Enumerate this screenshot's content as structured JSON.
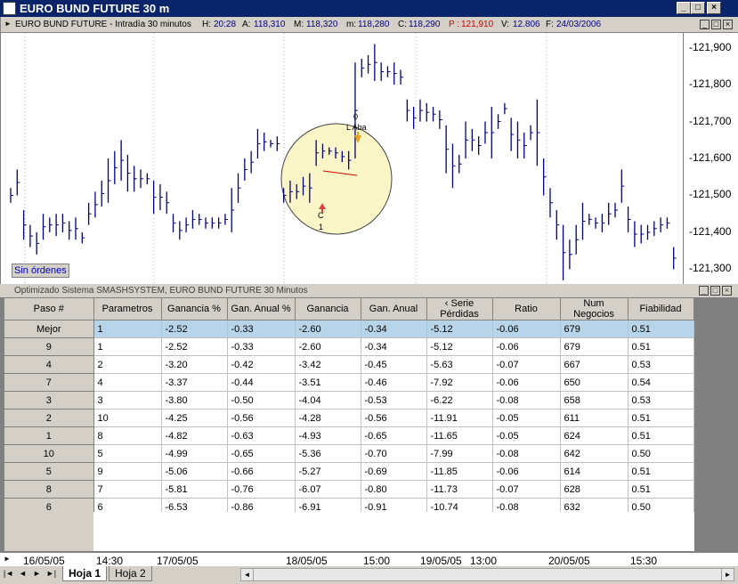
{
  "window": {
    "title": "EURO BUND FUTURE 30 m"
  },
  "infobar": {
    "instrument": "EURO BUND FUTURE - Intradía 30 minutos",
    "h_label": "H:",
    "h_value": "20:28",
    "a_label": "A:",
    "a_value": "118,310",
    "m_label": "M:",
    "m_value": "118,320",
    "mm_label": "m:",
    "mm_value": "118,280",
    "c_label": "C:",
    "c_value": "118,290",
    "p_label": "P :",
    "p_value": "121,910",
    "v_label": "V:",
    "v_value": "12.806",
    "f_label": "F:",
    "f_value": "24/03/2006"
  },
  "chart_data": {
    "type": "bar",
    "ohlc_price_axis": [
      "121,900",
      "121,800",
      "121,700",
      "121,600",
      "121,500",
      "121,400",
      "121,300"
    ],
    "ylim": [
      121260,
      121940
    ],
    "annotations": [
      "0",
      "L Aba",
      "C",
      "1"
    ],
    "bars": [
      [
        121520,
        121480
      ],
      [
        121570,
        121500
      ],
      [
        121460,
        121380
      ],
      [
        121420,
        121360
      ],
      [
        121400,
        121340
      ],
      [
        121450,
        121380
      ],
      [
        121440,
        121400
      ],
      [
        121450,
        121390
      ],
      [
        121450,
        121400
      ],
      [
        121430,
        121380
      ],
      [
        121440,
        121380
      ],
      [
        121400,
        121370
      ],
      [
        121480,
        121420
      ],
      [
        121510,
        121440
      ],
      [
        121540,
        121470
      ],
      [
        121600,
        121480
      ],
      [
        121620,
        121530
      ],
      [
        121650,
        121540
      ],
      [
        121610,
        121510
      ],
      [
        121580,
        121510
      ],
      [
        121570,
        121520
      ],
      [
        121560,
        121530
      ],
      [
        121540,
        121450
      ],
      [
        121530,
        121460
      ],
      [
        121510,
        121450
      ],
      [
        121450,
        121400
      ],
      [
        121430,
        121380
      ],
      [
        121440,
        121400
      ],
      [
        121460,
        121410
      ],
      [
        121450,
        121420
      ],
      [
        121440,
        121410
      ],
      [
        121440,
        121410
      ],
      [
        121440,
        121410
      ],
      [
        121450,
        121420
      ],
      [
        121520,
        121400
      ],
      [
        121560,
        121480
      ],
      [
        121600,
        121540
      ],
      [
        121620,
        121560
      ],
      [
        121680,
        121600
      ],
      [
        121670,
        121620
      ],
      [
        121650,
        121630
      ],
      [
        121660,
        121620
      ],
      [
        121520,
        121480
      ],
      [
        121540,
        121480
      ],
      [
        121530,
        121490
      ],
      [
        121550,
        121500
      ],
      [
        121560,
        121480
      ],
      [
        121650,
        121580
      ],
      [
        121640,
        121600
      ],
      [
        121630,
        121610
      ],
      [
        121630,
        121600
      ],
      [
        121620,
        121590
      ],
      [
        121620,
        121570
      ],
      [
        121860,
        121600
      ],
      [
        121870,
        121820
      ],
      [
        121880,
        121830
      ],
      [
        121910,
        121810
      ],
      [
        121860,
        121810
      ],
      [
        121850,
        121820
      ],
      [
        121860,
        121800
      ],
      [
        121840,
        121800
      ],
      [
        121760,
        121700
      ],
      [
        121740,
        121680
      ],
      [
        121760,
        121700
      ],
      [
        121750,
        121700
      ],
      [
        121740,
        121700
      ],
      [
        121730,
        121680
      ],
      [
        121690,
        121560
      ],
      [
        121640,
        121520
      ],
      [
        121610,
        121560
      ],
      [
        121700,
        121600
      ],
      [
        121680,
        121620
      ],
      [
        121660,
        121610
      ],
      [
        121700,
        121640
      ],
      [
        121740,
        121600
      ],
      [
        121720,
        121680
      ],
      [
        121750,
        121720
      ],
      [
        121710,
        121620
      ],
      [
        121700,
        121600
      ],
      [
        121670,
        121600
      ],
      [
        121690,
        121650
      ],
      [
        121760,
        121580
      ],
      [
        121600,
        121500
      ],
      [
        121520,
        121440
      ],
      [
        121460,
        121380
      ],
      [
        121420,
        121270
      ],
      [
        121380,
        121300
      ],
      [
        121420,
        121340
      ],
      [
        121480,
        121380
      ],
      [
        121450,
        121420
      ],
      [
        121440,
        121410
      ],
      [
        121450,
        121400
      ],
      [
        121480,
        121420
      ],
      [
        121480,
        121440
      ],
      [
        121570,
        121480
      ],
      [
        121470,
        121400
      ],
      [
        121430,
        121360
      ],
      [
        121420,
        121370
      ],
      [
        121420,
        121380
      ],
      [
        121430,
        121390
      ],
      [
        121440,
        121400
      ],
      [
        121440,
        121410
      ],
      [
        121360,
        121300
      ]
    ]
  },
  "chart_panel": {
    "orders_label": "Sin órdenes"
  },
  "optimizer": {
    "title": "Optimizado Sistema SMASHSYSTEM, EURO BUND FUTURE 30 Minutos",
    "columns": [
      "Paso #",
      "Parametros",
      "Ganancia %",
      "Gan. Anual %",
      "Ganancia",
      "Gan. Anual",
      "‹ Serie Pérdidas",
      "Ratio",
      "Num Negocios",
      "Fiabilidad"
    ],
    "rows": [
      [
        "Mejor",
        "1",
        "-2.52",
        "-0.33",
        "-2.60",
        "-0.34",
        "-5.12",
        "-0.06",
        "679",
        "0.51"
      ],
      [
        "9",
        "1",
        "-2.52",
        "-0.33",
        "-2.60",
        "-0.34",
        "-5.12",
        "-0.06",
        "679",
        "0.51"
      ],
      [
        "4",
        "2",
        "-3.20",
        "-0.42",
        "-3.42",
        "-0.45",
        "-5.63",
        "-0.07",
        "667",
        "0.53"
      ],
      [
        "7",
        "4",
        "-3.37",
        "-0.44",
        "-3.51",
        "-0.46",
        "-7.92",
        "-0.06",
        "650",
        "0.54"
      ],
      [
        "3",
        "3",
        "-3.80",
        "-0.50",
        "-4.04",
        "-0.53",
        "-6.22",
        "-0.08",
        "658",
        "0.53"
      ],
      [
        "2",
        "10",
        "-4.25",
        "-0.56",
        "-4.28",
        "-0.56",
        "-11.91",
        "-0.05",
        "611",
        "0.51"
      ],
      [
        "1",
        "8",
        "-4.82",
        "-0.63",
        "-4.93",
        "-0.65",
        "-11.65",
        "-0.05",
        "624",
        "0.51"
      ],
      [
        "10",
        "5",
        "-4.99",
        "-0.65",
        "-5.36",
        "-0.70",
        "-7.99",
        "-0.08",
        "642",
        "0.50"
      ],
      [
        "5",
        "9",
        "-5.06",
        "-0.66",
        "-5.27",
        "-0.69",
        "-11.85",
        "-0.06",
        "614",
        "0.51"
      ],
      [
        "8",
        "7",
        "-5.81",
        "-0.76",
        "-6.07",
        "-0.80",
        "-11.73",
        "-0.07",
        "628",
        "0.51"
      ],
      [
        "6",
        "6",
        "-6.53",
        "-0.86",
        "-6.91",
        "-0.91",
        "-10.74",
        "-0.08",
        "632",
        "0.50"
      ]
    ]
  },
  "time_axis": [
    "16/05/05",
    "14:30",
    "17/05/05",
    "18/05/05",
    "15:00",
    "19/05/05",
    "13:00",
    "20/05/05",
    "15:30"
  ],
  "tabs": [
    "Hoja 1",
    "Hoja 2"
  ],
  "colors": {
    "title_bg": "#0a246a",
    "best_row": "#b8d4e8",
    "price_red": "#cc0000",
    "value_blue": "#000080"
  }
}
